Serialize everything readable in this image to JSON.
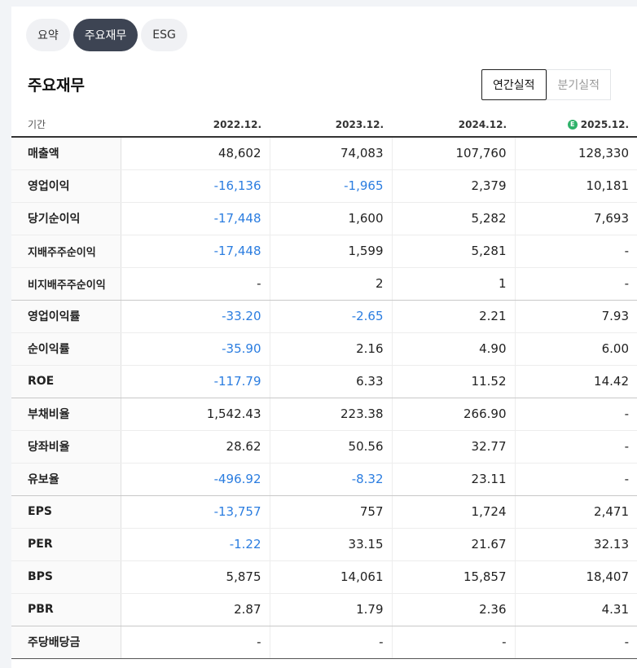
{
  "tabs": [
    {
      "label": "요약",
      "active": false
    },
    {
      "label": "주요재무",
      "active": true
    },
    {
      "label": "ESG",
      "active": false
    }
  ],
  "title": "주요재무",
  "period_toggle": {
    "annual": "연간실적",
    "quarterly": "분기실적",
    "selected": "연간실적"
  },
  "table": {
    "header_label": "기간",
    "columns": [
      "2022.12.",
      "2023.12.",
      "2024.12.",
      "2025.12."
    ],
    "estimate_icon": "E",
    "rows": [
      {
        "label": "매출액",
        "values": [
          "48,602",
          "74,083",
          "107,760",
          "128,330"
        ]
      },
      {
        "label": "영업이익",
        "values": [
          "-16,136",
          "-1,965",
          "2,379",
          "10,181"
        ]
      },
      {
        "label": "당기순이익",
        "values": [
          "-17,448",
          "1,600",
          "5,282",
          "7,693"
        ]
      },
      {
        "label": "지배주주순이익",
        "values": [
          "-17,448",
          "1,599",
          "5,281",
          "-"
        ]
      },
      {
        "label": "비지배주주순이익",
        "values": [
          "-",
          "2",
          "1",
          "-"
        ]
      },
      {
        "label": "영업이익률",
        "values": [
          "-33.20",
          "-2.65",
          "2.21",
          "7.93"
        ]
      },
      {
        "label": "순이익률",
        "values": [
          "-35.90",
          "2.16",
          "4.90",
          "6.00"
        ]
      },
      {
        "label": "ROE",
        "values": [
          "-117.79",
          "6.33",
          "11.52",
          "14.42"
        ]
      },
      {
        "label": "부채비율",
        "values": [
          "1,542.43",
          "223.38",
          "266.90",
          "-"
        ]
      },
      {
        "label": "당좌비율",
        "values": [
          "28.62",
          "50.56",
          "32.77",
          "-"
        ]
      },
      {
        "label": "유보율",
        "values": [
          "-496.92",
          "-8.32",
          "23.11",
          "-"
        ]
      },
      {
        "label": "EPS",
        "values": [
          "-13,757",
          "757",
          "1,724",
          "2,471"
        ]
      },
      {
        "label": "PER",
        "values": [
          "-1.22",
          "33.15",
          "21.67",
          "32.13"
        ]
      },
      {
        "label": "BPS",
        "values": [
          "5,875",
          "14,061",
          "15,857",
          "18,407"
        ]
      },
      {
        "label": "PBR",
        "values": [
          "2.87",
          "1.79",
          "2.36",
          "4.31"
        ]
      },
      {
        "label": "주당배당금",
        "values": [
          "-",
          "-",
          "-",
          "-"
        ]
      }
    ]
  },
  "colors": {
    "negative": "#2b7de0",
    "active_tab_bg": "#3d4453",
    "estimate_icon": "#2fb26a"
  }
}
